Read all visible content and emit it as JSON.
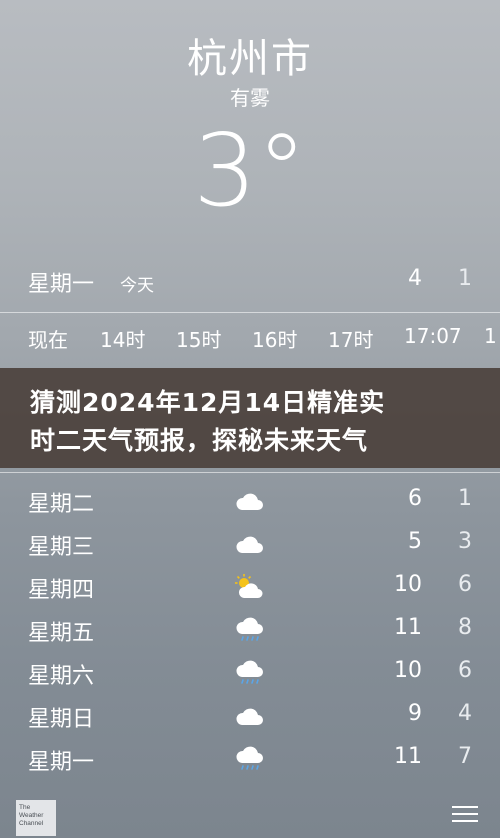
{
  "location": {
    "city": "杭州市",
    "condition": "有雾",
    "temperature": "3°"
  },
  "today": {
    "day": "星期一",
    "tag": "今天",
    "high": "4",
    "low": "1"
  },
  "hourly": [
    "现在",
    "14时",
    "15时",
    "16时",
    "17时",
    "17:07",
    "1"
  ],
  "banner": {
    "line1": "猜测2024年12月14日精准实",
    "line2": "时二天气预报，探秘未来天气"
  },
  "daily": [
    {
      "day": "星期二",
      "icon": "cloud-icon",
      "high": "6",
      "low": "1"
    },
    {
      "day": "星期三",
      "icon": "cloud-icon",
      "high": "5",
      "low": "3"
    },
    {
      "day": "星期四",
      "icon": "partly-sunny-icon",
      "high": "10",
      "low": "6"
    },
    {
      "day": "星期五",
      "icon": "rain-cloud-icon",
      "high": "11",
      "low": "8"
    },
    {
      "day": "星期六",
      "icon": "rain-cloud-icon",
      "high": "10",
      "low": "6"
    },
    {
      "day": "星期日",
      "icon": "cloud-icon",
      "high": "9",
      "low": "4"
    },
    {
      "day": "星期一",
      "icon": "rain-cloud-icon",
      "high": "11",
      "low": "7"
    }
  ],
  "footer": {
    "logo_text": [
      "The",
      "Weather",
      "Channel"
    ],
    "menu_icon": "list-menu-icon"
  },
  "colors": {
    "banner_bg": "#463a34",
    "text": "#ffffff"
  }
}
